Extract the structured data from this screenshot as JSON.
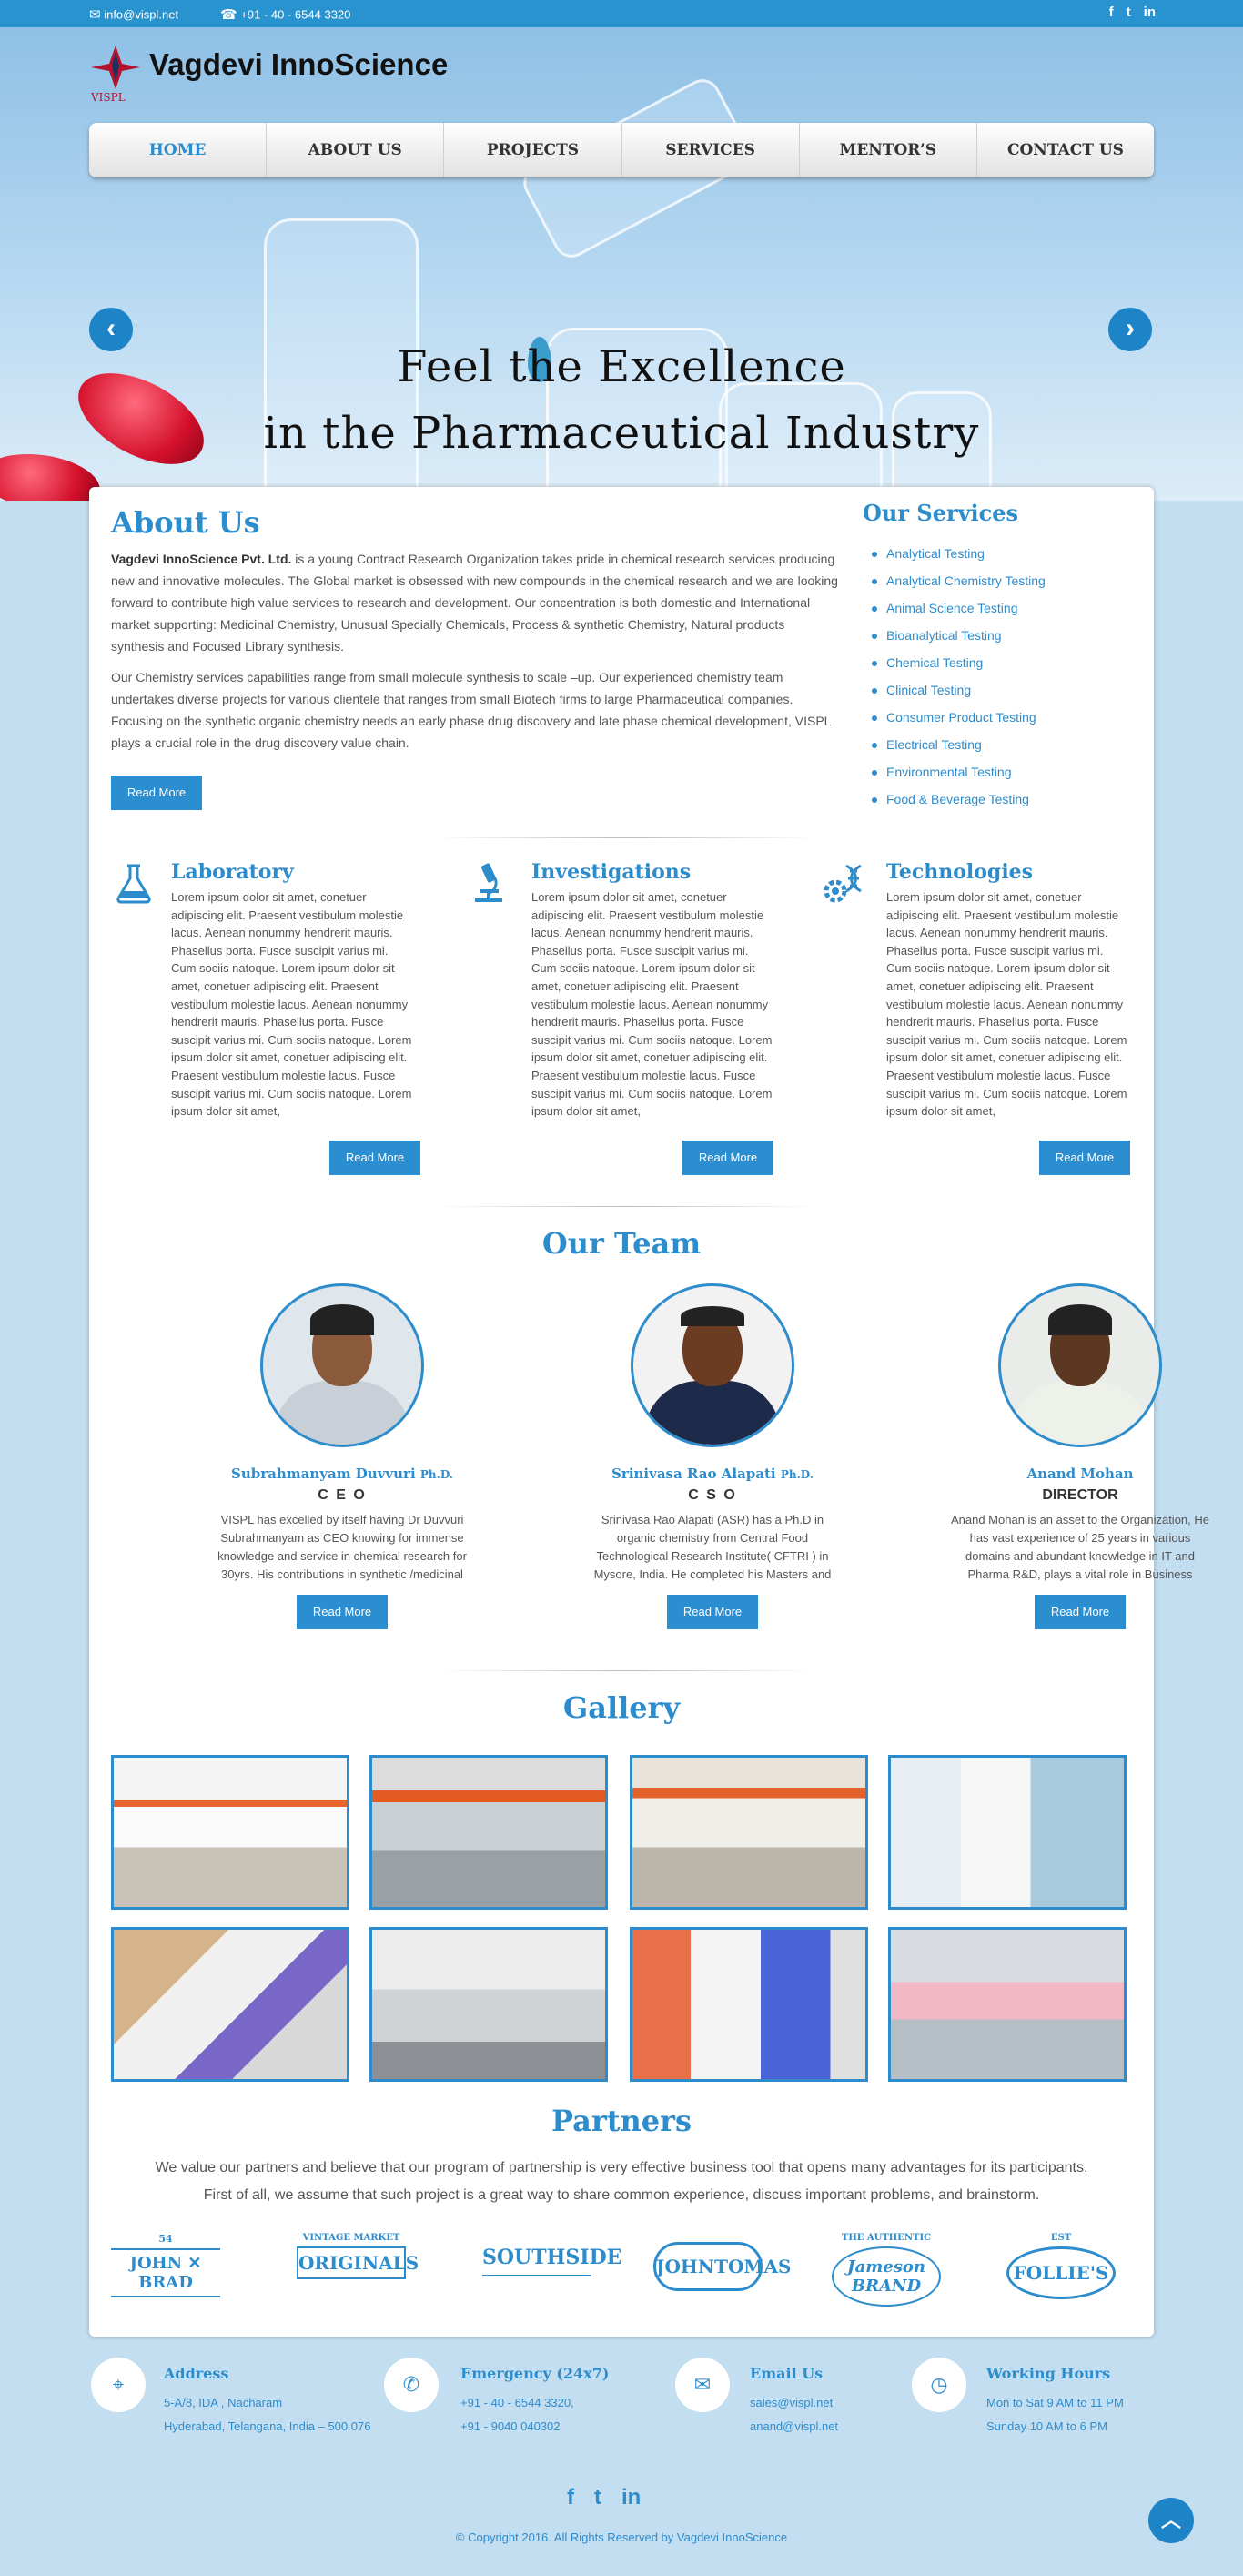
{
  "topbar": {
    "email": "info@vispl.net",
    "phone": "+91 - 40 - 6544 3320",
    "social": [
      "f",
      "t",
      "in"
    ]
  },
  "brand": {
    "name": "Vagdevi InnoScience",
    "abbr": "VISPL"
  },
  "nav": [
    "HOME",
    "ABOUT US",
    "PROJECTS",
    "SERVICES",
    "MENTOR’S",
    "CONTACT US"
  ],
  "hero": {
    "line1": "Feel the Excellence",
    "line2": "in the Pharmaceutical Industry",
    "prev": "‹",
    "next": "›"
  },
  "about": {
    "heading": "About Us",
    "company": "Vagdevi InnoScience Pvt. Ltd.",
    "p1": " is a young Contract Research Organization takes pride in chemical research services producing new and innovative molecules. The Global market is obsessed with new compounds in the chemical research and we are looking forward to contribute high value services to research and development. Our concentration is both domestic and International market supporting: Medicinal Chemistry, Unusual Specially Chemicals, Process & synthetic Chemistry, Natural products synthesis and Focused Library synthesis.",
    "p2": "Our Chemistry services capabilities range from small molecule synthesis to scale –up. Our experienced chemistry team undertakes diverse projects for various clientele that ranges from small Biotech firms to large Pharmaceutical companies. Focusing on the synthetic organic chemistry needs an early phase drug discovery and late phase chemical development, VISPL plays a crucial role in the drug discovery value chain.",
    "button": "Read More"
  },
  "services": {
    "heading": "Our Services",
    "items": [
      "Analytical Testing",
      "Analytical Chemistry Testing",
      "Animal Science Testing",
      "Bioanalytical Testing",
      "Chemical Testing",
      "Clinical Testing",
      "Consumer Product Testing",
      "Electrical Testing",
      "Environmental Testing",
      "Food & Beverage Testing"
    ]
  },
  "features": [
    {
      "title": "Laboratory",
      "icon": "flask-icon",
      "text": "Lorem ipsum dolor sit  amet, conetuer adipiscing elit. Praesent vestibulum molestie lacus. Aenean nonummy hendrerit mauris. Phasellus porta. Fusce suscipit varius mi. Cum sociis natoque. Lorem ipsum dolor sit amet, conetuer adipiscing elit. Praesent vestibulum molestie lacus. Aenean nonummy hendrerit mauris. Phasellus porta. Fusce suscipit varius mi. Cum sociis natoque. Lorem ipsum dolor sit amet, conetuer adipiscing elit. Praesent vestibulum molestie lacus.  Fusce suscipit varius mi. Cum sociis natoque. Lorem ipsum dolor sit amet,",
      "button": "Read More"
    },
    {
      "title": "Investigations",
      "icon": "microscope-icon",
      "text": "Lorem ipsum dolor sit  amet, conetuer adipiscing elit. Praesent vestibulum molestie lacus. Aenean nonummy hendrerit mauris. Phasellus porta. Fusce suscipit varius mi. Cum sociis natoque. Lorem ipsum dolor sit amet, conetuer adipiscing elit. Praesent vestibulum molestie lacus. Aenean nonummy hendrerit mauris. Phasellus porta. Fusce suscipit varius mi. Cum sociis natoque. Lorem ipsum dolor sit amet, conetuer adipiscing elit. Praesent vestibulum molestie lacus.  Fusce suscipit varius mi. Cum sociis natoque. Lorem ipsum dolor sit amet,",
      "button": "Read More"
    },
    {
      "title": "Technologies",
      "icon": "dna-gear-icon",
      "text": "Lorem ipsum dolor sit  amet, conetuer adipiscing elit. Praesent vestibulum molestie lacus. Aenean nonummy hendrerit mauris. Phasellus porta. Fusce suscipit varius mi. Cum sociis natoque. Lorem ipsum dolor sit amet, conetuer adipiscing elit. Praesent vestibulum molestie lacus. Aenean nonummy hendrerit mauris. Phasellus porta. Fusce suscipit varius mi. Cum sociis natoque. Lorem ipsum dolor sit amet, conetuer adipiscing elit. Praesent vestibulum molestie lacus.  Fusce suscipit varius mi. Cum sociis natoque. Lorem ipsum dolor sit amet,",
      "button": "Read More"
    }
  ],
  "team": {
    "heading": "Our Team",
    "members": [
      {
        "name": "Subrahmanyam Duvvuri",
        "degree": "Ph.D.",
        "role": "C E O",
        "bio": "VISPL has excelled by itself having Dr Duvvuri Subrahmanyam as CEO knowing for immense knowledge and service in chemical research for 30yrs. His contributions in synthetic /medicinal chemistry over",
        "button": "Read More"
      },
      {
        "name": "Srinivasa Rao Alapati",
        "degree": "Ph.D.",
        "role": "C S O",
        "bio": "Srinivasa Rao Alapati (ASR) has a Ph.D in organic chemistry from Central Food Technological Research Institute( CFTRI ) in Mysore, India. He completed his Masters and M.Phil degrees from Univ. of Hyderabad.",
        "button": "Read More"
      },
      {
        "name": "Anand Mohan",
        "degree": "",
        "role": "DIRECTOR",
        "bio": "Anand Mohan is an asset to the Organization, He has vast experience of 25 years in various domains and abundant knowledge in IT and Pharma R&D, plays a vital role in Business development, project Management",
        "button": "Read More"
      }
    ]
  },
  "gallery": {
    "heading": "Gallery"
  },
  "partners": {
    "heading": "Partners",
    "line1": "We value our partners and believe that our program of partnership is very effective business tool that opens many advantages for its participants.",
    "line2": "First of all, we assume that such project is a great way to share common experience, discuss important problems, and brainstorm.",
    "logos": [
      {
        "main": "JOHN ✕ BRAD",
        "top": "54"
      },
      {
        "main": "ORIGINALS",
        "top": "VINTAGE MARKET"
      },
      {
        "main": "SOUTHSIDE",
        "top": ""
      },
      {
        "main": "JOHNTOMAS",
        "top": ""
      },
      {
        "main": "Jameson BRAND",
        "top": "THE AUTHENTIC"
      },
      {
        "main": "FOLLIE'S",
        "top": "EST"
      }
    ]
  },
  "footer": {
    "address": {
      "title": "Address",
      "line1": "5-A/8, IDA , Nacharam",
      "line2": "Hyderabad, Telangana, India – 500 076"
    },
    "emergency": {
      "title": "Emergency (24x7)",
      "line1": "+91 - 40 - 6544 3320,",
      "line2": "+91 - 9040 040302"
    },
    "email": {
      "title": "Email Us",
      "line1": "sales@vispl.net",
      "line2": "anand@vispl.net"
    },
    "hours": {
      "title": "Working Hours",
      "line1": "Mon to Sat 9 AM to 11 PM",
      "line2": "Sunday 10 AM to 6 PM"
    },
    "social": [
      "f",
      "t",
      "in"
    ],
    "copyright": "© Copyright 2016. All Rights Reserved by Vagdevi InnoScience"
  },
  "colors": {
    "accent": "#2d8ccc",
    "topbar": "#2893cf",
    "background": "#c3def1"
  }
}
